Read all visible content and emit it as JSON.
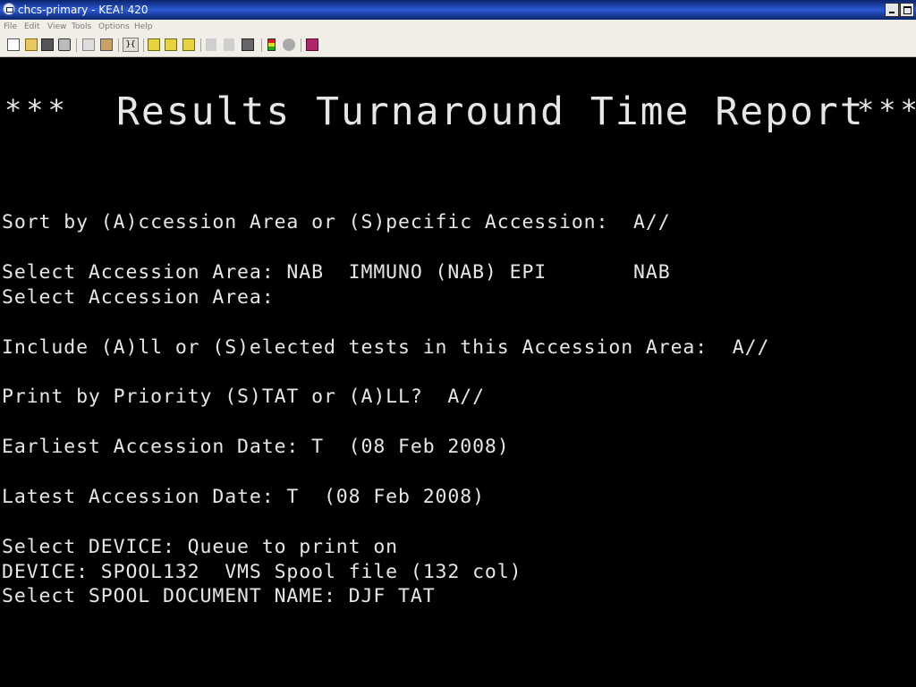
{
  "window": {
    "title": "chcs-primary - KEA! 420"
  },
  "menu": {
    "items": [
      "File",
      "Edit",
      "View",
      "Tools",
      "Options",
      "Help"
    ]
  },
  "toolbar": {
    "mode_label": "}{"
  },
  "terminal": {
    "banner_left": "***",
    "banner_title": "Results Turnaround Time Report",
    "banner_right": "***",
    "lines": [
      "Sort by (A)ccession Area or (S)pecific Accession:  A//",
      "Select Accession Area: NAB  IMMUNO (NAB) EPI       NAB",
      "Select Accession Area:",
      "Include (A)ll or (S)elected tests in this Accession Area:  A//",
      "Print by Priority (S)TAT or (A)LL?  A//",
      "Earliest Accession Date: T  (08 Feb 2008)",
      "Latest Accession Date: T  (08 Feb 2008)",
      "Select DEVICE: Queue to print on",
      "DEVICE: SPOOL132  VMS Spool file (132 col)",
      "Select SPOOL DOCUMENT NAME: DJF TAT"
    ]
  }
}
